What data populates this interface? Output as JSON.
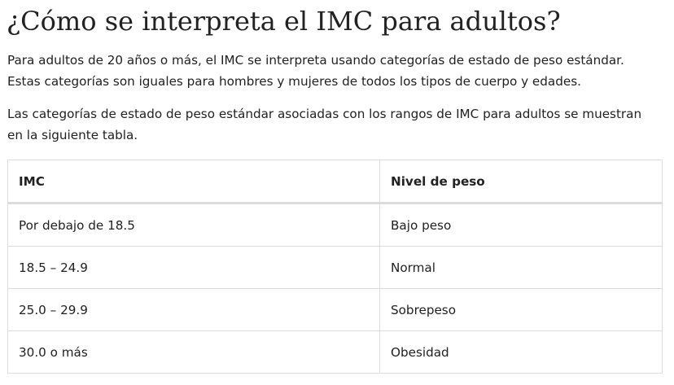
{
  "page": {
    "title": "¿Cómo se interpreta el IMC para adultos?",
    "paragraph1_lines": [
      "Para adultos de 20 años o más, el IMC se interpreta usando categorías de estado de peso estándar.",
      "Estas categorías son iguales para hombres y mujeres de todos los tipos de cuerpo y edades."
    ],
    "paragraph2_lines": [
      "Las categorías de estado de peso estándar asociadas con los rangos de IMC para adultos se muestran",
      "en la siguiente tabla."
    ]
  },
  "table": {
    "headers": [
      "IMC",
      "Nivel de peso"
    ],
    "rows": [
      [
        "Por debajo de 18.5",
        "Bajo peso"
      ],
      [
        "18.5 – 24.9",
        "Normal"
      ],
      [
        "25.0 – 29.9",
        "Sobrepeso"
      ],
      [
        "30.0 o más",
        "Obesidad"
      ]
    ]
  }
}
